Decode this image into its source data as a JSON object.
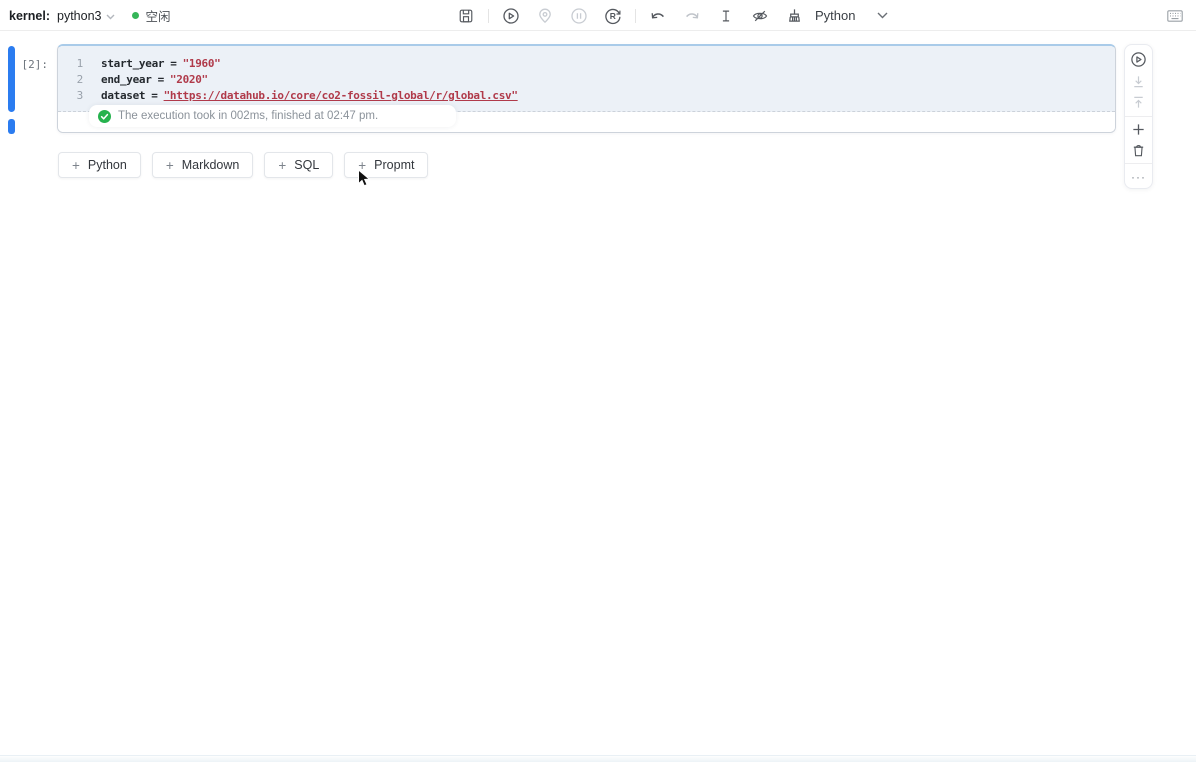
{
  "toolbar": {
    "kernel_label": "kernel:",
    "kernel_name": "python3",
    "kernel_status": "空闲",
    "language_selector": "Python",
    "center_icons": [
      "save",
      "run",
      "locate",
      "pause",
      "restart",
      "undo",
      "redo",
      "text-cursor",
      "hide-output",
      "clean-outputs"
    ],
    "right_icon": "keyboard-shortcuts"
  },
  "cell": {
    "exec_count": "[2]:",
    "lines": [
      {
        "num": "1",
        "var": "start_year",
        "op": "=",
        "str": "\"1960\""
      },
      {
        "num": "2",
        "var": "end_year",
        "op": "=",
        "str": "\"2020\""
      },
      {
        "num": "3",
        "var": "dataset",
        "op": "=",
        "str": "\"https://datahub.io/core/co2-fossil-global/r/global.csv\""
      }
    ],
    "status_text": "The execution took in 002ms, finished at 02:47 pm."
  },
  "add_buttons": {
    "plus": "+",
    "items": [
      {
        "label": "Python"
      },
      {
        "label": "Markdown"
      },
      {
        "label": "SQL"
      },
      {
        "label": "Propmt"
      }
    ]
  },
  "cell_toolbar": {
    "icons": [
      "run-cell",
      "move-down",
      "move-up",
      "add-cell",
      "delete-cell",
      "more-actions"
    ],
    "more_glyph": "···"
  },
  "colors": {
    "selection_blue": "#2b7cf0",
    "cell_top_border": "#a9cbe9",
    "code_background": "#ecf1f7",
    "string_red": "#b03a4a",
    "success_green": "#26b24e",
    "icon_gray": "#55595f",
    "icon_disabled": "#c8ccd2"
  }
}
